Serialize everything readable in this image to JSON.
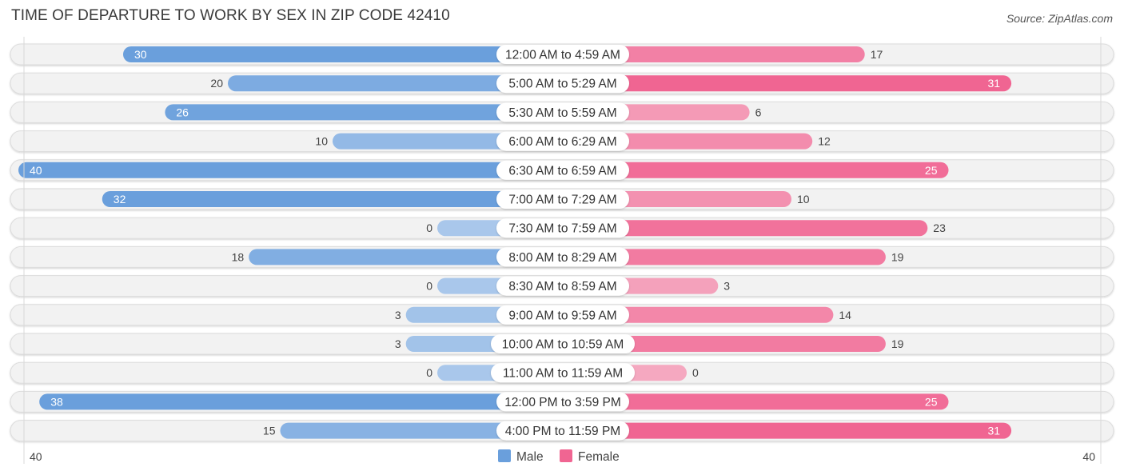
{
  "title": "TIME OF DEPARTURE TO WORK BY SEX IN ZIP CODE 42410",
  "source": "Source: ZipAtlas.com",
  "colors": {
    "male_strong": "#6a9fdc",
    "male_light": "#a9c7eb",
    "female_strong": "#f06592",
    "female_light": "#f5a8c0",
    "row_bg": "#f2f2f2",
    "label_bg": "#ffffff"
  },
  "chart_data": {
    "type": "bar",
    "orientation": "horizontal-diverging",
    "title": "TIME OF DEPARTURE TO WORK BY SEX IN ZIP CODE 42410",
    "categories": [
      "12:00 AM to 4:59 AM",
      "5:00 AM to 5:29 AM",
      "5:30 AM to 5:59 AM",
      "6:00 AM to 6:29 AM",
      "6:30 AM to 6:59 AM",
      "7:00 AM to 7:29 AM",
      "7:30 AM to 7:59 AM",
      "8:00 AM to 8:29 AM",
      "8:30 AM to 8:59 AM",
      "9:00 AM to 9:59 AM",
      "10:00 AM to 10:59 AM",
      "11:00 AM to 11:59 AM",
      "12:00 PM to 3:59 PM",
      "4:00 PM to 11:59 PM"
    ],
    "series": [
      {
        "name": "Male",
        "values": [
          30,
          20,
          26,
          10,
          40,
          32,
          0,
          18,
          0,
          3,
          3,
          0,
          38,
          15
        ]
      },
      {
        "name": "Female",
        "values": [
          17,
          31,
          6,
          12,
          25,
          10,
          23,
          19,
          3,
          14,
          19,
          0,
          25,
          31
        ]
      }
    ],
    "xlim": [
      40,
      40
    ],
    "axis_left_label": "40",
    "axis_right_label": "40",
    "legend": {
      "position": "bottom-center",
      "entries": [
        "Male",
        "Female"
      ]
    },
    "grid": false,
    "xlabel": "",
    "ylabel": ""
  }
}
